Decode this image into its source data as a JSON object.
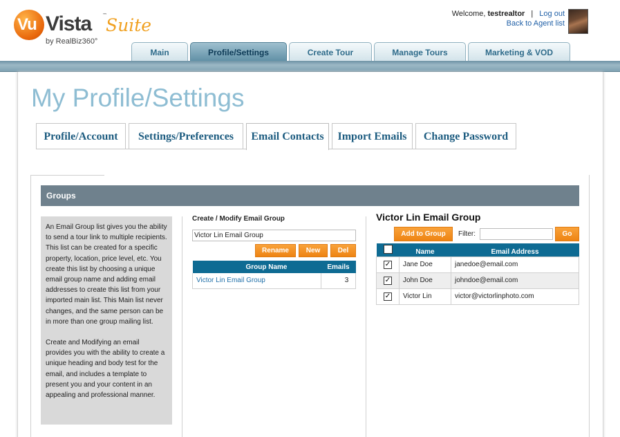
{
  "header": {
    "logo": {
      "vu": "Vu",
      "vista": "Vista",
      "tm": "™",
      "suite": "Suite",
      "by": "by RealBiz360°"
    },
    "welcome_text": "Welcome,",
    "username": "testrealtor",
    "separator": "|",
    "logout_label": "Log out",
    "back_label": "Back to Agent list"
  },
  "main_nav": {
    "tabs": [
      {
        "label": "Main"
      },
      {
        "label": "Profile/Settings"
      },
      {
        "label": "Create Tour"
      },
      {
        "label": "Manage Tours"
      },
      {
        "label": "Marketing & VOD"
      }
    ],
    "active_index": 1
  },
  "page": {
    "title": "My Profile/Settings",
    "subtabs": [
      {
        "label": "Profile/Account"
      },
      {
        "label": "Settings/Preferences"
      },
      {
        "label": "Email Contacts"
      },
      {
        "label": "Import Emails"
      },
      {
        "label": "Change Password"
      }
    ],
    "active_subtab": 2
  },
  "groups": {
    "header": "Groups",
    "description_1": "An Email Group list gives you the ability to send a tour link to multiple recipients. This list can be created for a specific property, location, price level, etc. You create this list by choosing a unique email group name and adding email addresses to create this list from your imported main list. This Main list never changes, and the same person can be in more than one group mailing list.",
    "description_2": "Create and Modifying an email provides you with the ability to create a unique heading and body test for the email, and includes a template to present you and your content in an appealing and professional manner."
  },
  "create_modify": {
    "title": "Create / Modify Email Group",
    "input_value": "Victor Lin Email Group",
    "rename_label": "Rename",
    "new_label": "New",
    "del_label": "Del",
    "columns": {
      "name": "Group Name",
      "emails": "Emails"
    },
    "rows": [
      {
        "name": "Victor Lin Email Group",
        "emails": "3"
      }
    ]
  },
  "group_detail": {
    "title": "Victor Lin Email Group",
    "add_label": "Add to Group",
    "filter_label": "Filter:",
    "go_label": "Go",
    "columns": {
      "name": "Name",
      "email": "Email Address"
    },
    "contacts": [
      {
        "name": "Jane Doe",
        "email": "janedoe@email.com",
        "checked": "✓"
      },
      {
        "name": "John Doe",
        "email": "johndoe@email.com",
        "checked": "✓"
      },
      {
        "name": "Victor Lin",
        "email": "victor@victorlinphoto.com",
        "checked": "✓"
      }
    ]
  },
  "colors": {
    "accent_orange": "#ee8413",
    "table_header": "#0e6b93",
    "nav_active": "#5f8fa5",
    "title_blue": "#8ebdd3"
  }
}
